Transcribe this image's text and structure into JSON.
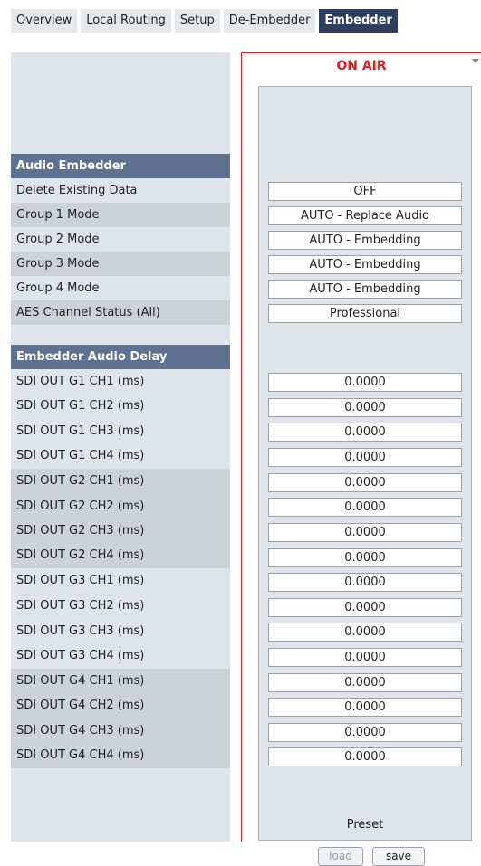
{
  "tabs": [
    "Overview",
    "Local Routing",
    "Setup",
    "De-Embedder",
    "Embedder"
  ],
  "active_tab": "Embedder",
  "status": "ON AIR",
  "audio_embedder": {
    "header": "Audio Embedder",
    "rows": [
      {
        "label": "Delete Existing Data",
        "value": "OFF"
      },
      {
        "label": "Group 1 Mode",
        "value": "AUTO - Replace Audio"
      },
      {
        "label": "Group 2 Mode",
        "value": "AUTO - Embedding"
      },
      {
        "label": "Group 3 Mode",
        "value": "AUTO - Embedding"
      },
      {
        "label": "Group 4 Mode",
        "value": "AUTO - Embedding"
      },
      {
        "label": "AES Channel Status (All)",
        "value": "Professional"
      }
    ]
  },
  "audio_delay": {
    "header": "Embedder Audio Delay",
    "rows": [
      {
        "label": "SDI OUT G1 CH1 (ms)",
        "value": "0.0000"
      },
      {
        "label": "SDI OUT G1 CH2 (ms)",
        "value": "0.0000"
      },
      {
        "label": "SDI OUT G1 CH3 (ms)",
        "value": "0.0000"
      },
      {
        "label": "SDI OUT G1 CH4 (ms)",
        "value": "0.0000"
      },
      {
        "label": "SDI OUT G2 CH1 (ms)",
        "value": "0.0000"
      },
      {
        "label": "SDI OUT G2 CH2 (ms)",
        "value": "0.0000"
      },
      {
        "label": "SDI OUT G2 CH3 (ms)",
        "value": "0.0000"
      },
      {
        "label": "SDI OUT G2 CH4 (ms)",
        "value": "0.0000"
      },
      {
        "label": "SDI OUT G3 CH1 (ms)",
        "value": "0.0000"
      },
      {
        "label": "SDI OUT G3 CH2 (ms)",
        "value": "0.0000"
      },
      {
        "label": "SDI OUT G3 CH3 (ms)",
        "value": "0.0000"
      },
      {
        "label": "SDI OUT G3 CH4 (ms)",
        "value": "0.0000"
      },
      {
        "label": "SDI OUT G4 CH1 (ms)",
        "value": "0.0000"
      },
      {
        "label": "SDI OUT G4 CH2 (ms)",
        "value": "0.0000"
      },
      {
        "label": "SDI OUT G4 CH3 (ms)",
        "value": "0.0000"
      },
      {
        "label": "SDI OUT G4 CH4 (ms)",
        "value": "0.0000"
      }
    ]
  },
  "preset": {
    "label": "Preset",
    "load_label": "load",
    "save_label": "save"
  }
}
